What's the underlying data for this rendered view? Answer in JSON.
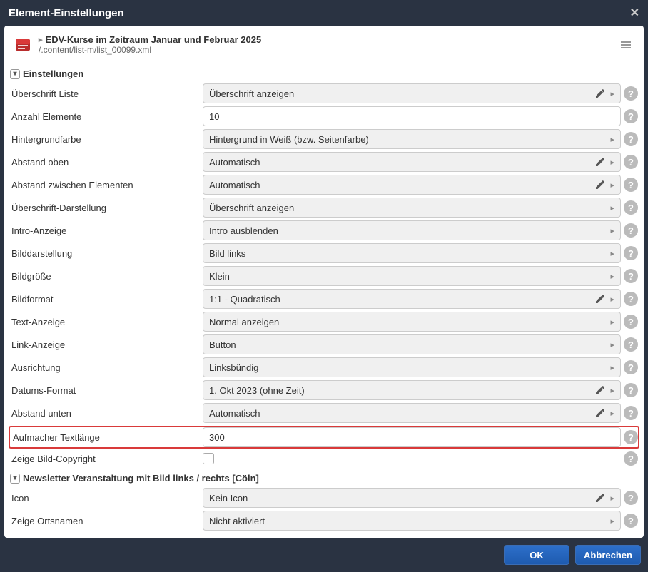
{
  "dialog": {
    "title": "Element-Einstellungen"
  },
  "header": {
    "breadcrumb_title": "EDV-Kurse im Zeitraum Januar und Februar 2025",
    "path": "/.content/list-m/list_00099.xml"
  },
  "section1": {
    "title": "Einstellungen",
    "rows": [
      {
        "label": "Überschrift Liste",
        "value": "Überschrift anzeigen",
        "type": "select",
        "editable": true
      },
      {
        "label": "Anzahl Elemente",
        "value": "10",
        "type": "text"
      },
      {
        "label": "Hintergrundfarbe",
        "value": "Hintergrund in Weiß (bzw. Seitenfarbe)",
        "type": "select",
        "editable": false
      },
      {
        "label": "Abstand oben",
        "value": "Automatisch",
        "type": "select",
        "editable": true
      },
      {
        "label": "Abstand zwischen Elementen",
        "value": "Automatisch",
        "type": "select",
        "editable": true
      },
      {
        "label": "Überschrift-Darstellung",
        "value": "Überschrift anzeigen",
        "type": "select",
        "editable": false
      },
      {
        "label": "Intro-Anzeige",
        "value": "Intro ausblenden",
        "type": "select",
        "editable": false
      },
      {
        "label": "Bilddarstellung",
        "value": "Bild links",
        "type": "select",
        "editable": false
      },
      {
        "label": "Bildgröße",
        "value": "Klein",
        "type": "select",
        "editable": false
      },
      {
        "label": "Bildformat",
        "value": "1:1 - Quadratisch",
        "type": "select",
        "editable": true
      },
      {
        "label": "Text-Anzeige",
        "value": "Normal anzeigen",
        "type": "select",
        "editable": false
      },
      {
        "label": "Link-Anzeige",
        "value": "Button",
        "type": "select",
        "editable": false
      },
      {
        "label": "Ausrichtung",
        "value": "Linksbündig",
        "type": "select",
        "editable": false
      },
      {
        "label": "Datums-Format",
        "value": "1. Okt 2023 (ohne Zeit)",
        "type": "select",
        "editable": true
      },
      {
        "label": "Abstand unten",
        "value": "Automatisch",
        "type": "select",
        "editable": true
      },
      {
        "label": "Aufmacher Textlänge",
        "value": "300",
        "type": "text",
        "highlighted": true
      },
      {
        "label": "Zeige Bild-Copyright",
        "value": "",
        "type": "checkbox"
      }
    ]
  },
  "section2": {
    "title": "Newsletter Veranstaltung mit Bild links / rechts [Cöln]",
    "rows": [
      {
        "label": "Icon",
        "value": "Kein Icon",
        "type": "select",
        "editable": true
      },
      {
        "label": "Zeige Ortsnamen",
        "value": "Nicht aktiviert",
        "type": "select",
        "editable": false
      }
    ]
  },
  "footer": {
    "ok": "OK",
    "cancel": "Abbrechen"
  }
}
